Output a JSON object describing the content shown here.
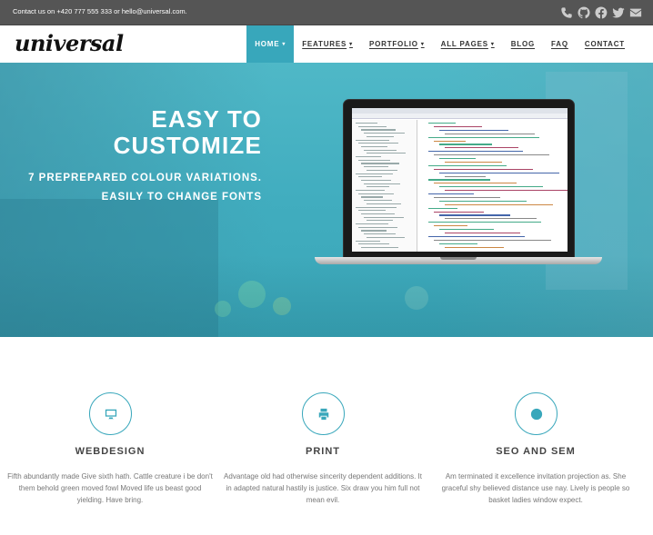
{
  "topbar": {
    "contact": "Contact us on +420 777 555 333 or hello@universal.com.",
    "social_icons": [
      "phone-icon",
      "github-icon",
      "facebook-icon",
      "twitter-icon",
      "envelope-icon"
    ]
  },
  "header": {
    "logo": "universal"
  },
  "nav": {
    "items": [
      {
        "label": "Home",
        "dropdown": true,
        "active": true
      },
      {
        "label": "Features",
        "dropdown": true
      },
      {
        "label": "Portfolio",
        "dropdown": true
      },
      {
        "label": "All Pages",
        "dropdown": true
      },
      {
        "label": "Blog"
      },
      {
        "label": "FAQ"
      },
      {
        "label": "Contact"
      }
    ],
    "caret": "▾"
  },
  "hero": {
    "title_line1": "Easy to",
    "title_line2": "customize",
    "subtitle1": "7 preprepared colour variations.",
    "subtitle2": "Easily to change fonts",
    "slide_count": 4,
    "active_slide": 4
  },
  "features": [
    {
      "icon": "desktop-icon",
      "title": "Webdesign",
      "text": "Fifth abundantly made Give sixth hath. Cattle creature i be don't them behold green moved fowl Moved life us beast good yielding. Have bring."
    },
    {
      "icon": "print-icon",
      "title": "Print",
      "text": "Advantage old had otherwise sincerity dependent additions. It in adapted natural hastily is justice. Six draw you him full not mean evil."
    },
    {
      "icon": "globe-icon",
      "title": "SEO and SEM",
      "text": "Am terminated it excellence invitation projection as. She graceful shy believed distance use nay. Lively is people so basket ladies window expect."
    }
  ],
  "colors": {
    "accent": "#38a7bb",
    "topbar": "#555555",
    "hero": "#41adbf"
  }
}
